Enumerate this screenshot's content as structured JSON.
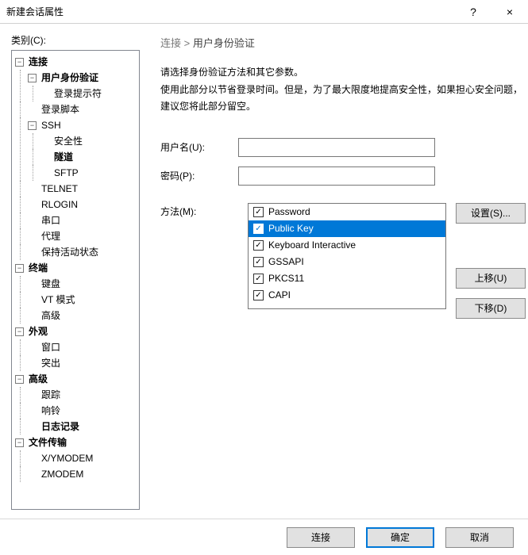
{
  "window": {
    "title": "新建会话属性",
    "help": "?",
    "close": "×"
  },
  "category_label": "类别(C):",
  "tree": {
    "connection": "连接",
    "user_auth": "用户身份验证",
    "login_prompt": "登录提示符",
    "login_script": "登录脚本",
    "ssh": "SSH",
    "security": "安全性",
    "tunnel": "隧道",
    "sftp": "SFTP",
    "telnet": "TELNET",
    "rlogin": "RLOGIN",
    "serial": "串口",
    "proxy": "代理",
    "keepalive": "保持活动状态",
    "terminal": "终端",
    "keyboard": "键盘",
    "vtmode": "VT 模式",
    "advanced1": "高级",
    "appearance": "外观",
    "window": "窗口",
    "highlight": "突出",
    "advanced2": "高级",
    "trace": "跟踪",
    "bell": "响铃",
    "log": "日志记录",
    "filetransfer": "文件传输",
    "xymodem": "X/YMODEM",
    "zmodem": "ZMODEM"
  },
  "breadcrumb": {
    "root": "连接",
    "sep": ">",
    "current": "用户身份验证"
  },
  "desc": {
    "l1": "请选择身份验证方法和其它参数。",
    "l2": "使用此部分以节省登录时间。但是，为了最大限度地提高安全性，如果担心安全问题，建议您将此部分留空。"
  },
  "form": {
    "username_label": "用户名(U):",
    "password_label": "密码(P):",
    "method_label": "方法(M):"
  },
  "methods": [
    {
      "label": "Password",
      "checked": true,
      "selected": false
    },
    {
      "label": "Public Key",
      "checked": true,
      "selected": true
    },
    {
      "label": "Keyboard Interactive",
      "checked": true,
      "selected": false
    },
    {
      "label": "GSSAPI",
      "checked": true,
      "selected": false
    },
    {
      "label": "PKCS11",
      "checked": true,
      "selected": false
    },
    {
      "label": "CAPI",
      "checked": true,
      "selected": false
    }
  ],
  "side_buttons": {
    "setup": "设置(S)...",
    "up": "上移(U)",
    "down": "下移(D)"
  },
  "footer": {
    "connect": "连接",
    "ok": "确定",
    "cancel": "取消"
  }
}
